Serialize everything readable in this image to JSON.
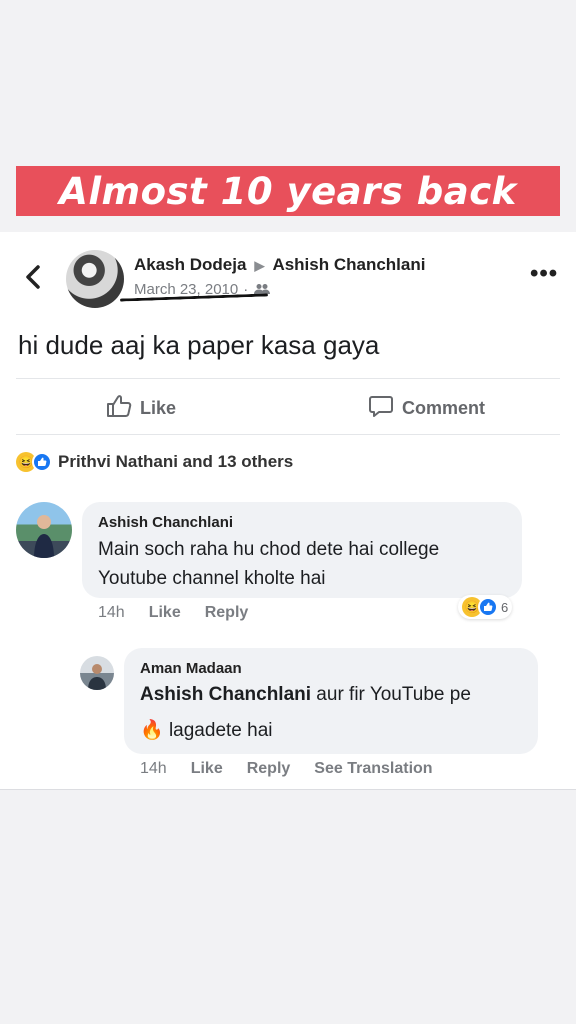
{
  "banner": {
    "text": "Almost 10 years back",
    "color": "#e8505b"
  },
  "post": {
    "back_icon": "chevron-left-icon",
    "author": "Akash Dodeja",
    "arrow": "▶",
    "target": "Ashish Chanchlani",
    "date": "March 23, 2010",
    "dot": "·",
    "audience_icon": "friends-icon",
    "more_label": "•••",
    "text": "hi dude aaj ka paper kasa gaya"
  },
  "actions": {
    "like_label": "Like",
    "comment_label": "Comment"
  },
  "reactions": {
    "summary": "Prithvi Nathani and 13 others"
  },
  "comments": [
    {
      "name": "Ashish Chanchlani",
      "text": "Main soch raha hu chod dete hai college Youtube channel kholte hai",
      "time": "14h",
      "like": "Like",
      "reply": "Reply",
      "reaction_count": "6"
    }
  ],
  "reply": {
    "name": "Aman Madaan",
    "mention": "Ashish Chanchlani",
    "text_1": " aur fir YouTube pe",
    "emoji": "🔥",
    "text_2": " lagadete hai",
    "time": "14h",
    "like": "Like",
    "reply": "Reply",
    "translate": "See Translation"
  }
}
